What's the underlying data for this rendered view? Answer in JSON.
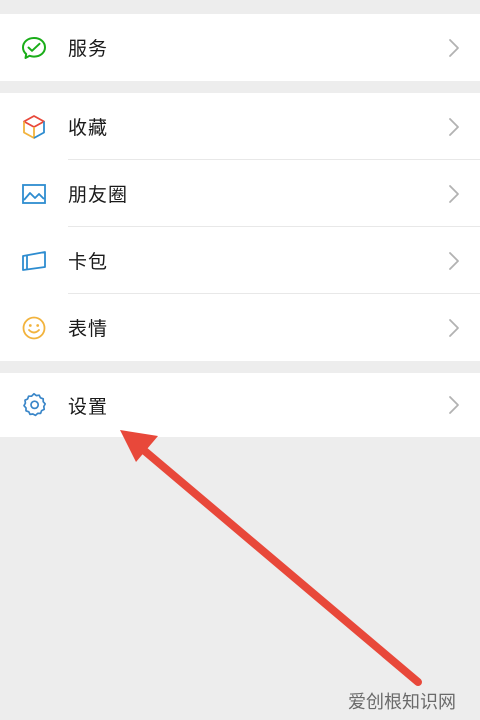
{
  "menu": {
    "service": "服务",
    "favorites": "收藏",
    "moments": "朋友圈",
    "cards": "卡包",
    "stickers": "表情",
    "settings": "设置"
  },
  "icons": {
    "service": "service-icon",
    "favorites": "cube-icon",
    "moments": "picture-icon",
    "cards": "card-icon",
    "stickers": "smiley-icon",
    "settings": "gear-icon",
    "chevron": "chevron-right-icon"
  },
  "colors": {
    "service": "#1aad19",
    "moments": "#2d8cd0",
    "cards": "#2d8cd0",
    "stickers": "#f2b33d",
    "settings": "#3a86c8",
    "annotation_arrow": "#e8483a"
  },
  "watermark": "爱创根知识网"
}
